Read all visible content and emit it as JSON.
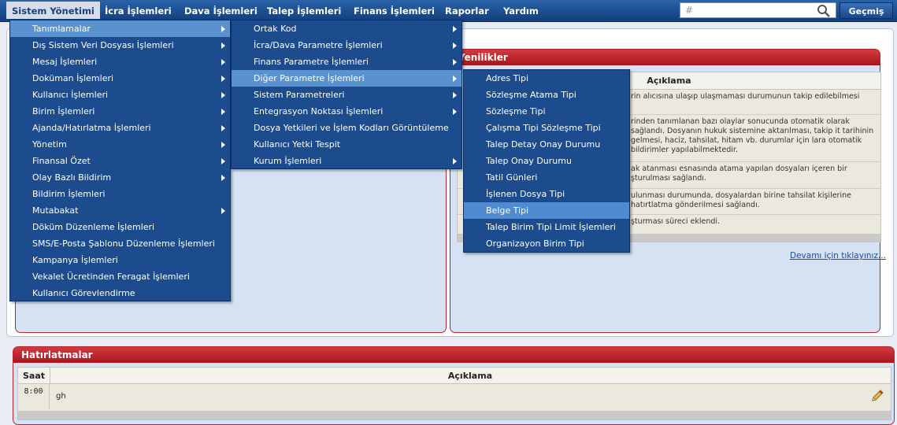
{
  "topbar": {
    "items": [
      "Sistem Yönetimi",
      "İcra İşlemleri",
      "Dava İşlemleri",
      "Talep İşlemleri",
      "Finans İşlemleri",
      "Raporlar",
      "Yardım"
    ],
    "search_placeholder": "#",
    "history_label": "Geçmiş"
  },
  "news_panel": {
    "title": "Yenilikler",
    "column": "Açıklama",
    "rows": [
      "rin alıcısına ulaşıp ulaşmaması durumunun takip edilebilmesi",
      "rinden tanımlanan bazı olaylar sonucunda otomatik olarak sağlandı. Dosyanın hukuk sistemine aktarılması, takip it tarihinin gelmesi, haciz, tahsilat, hitam vb. durumlar için lara otomatik bildirimler yapılabilmektedir.",
      "ak atanması esnasında atama yapılan dosyaları içeren bir şturulması sağlandı.",
      "ulunması durumunda, dosyalardan birine tahsilat kişilerine hatırtlatma gönderilmesi sağlandı.",
      "şturması süreci eklendi."
    ],
    "more_link": "Devamı için tıklayınız..."
  },
  "reminders": {
    "title": "Hatırlatmalar",
    "col_time": "Saat",
    "col_desc": "Açıklama",
    "rows": [
      {
        "time": "8:00",
        "desc": "gh"
      }
    ]
  },
  "menu1": {
    "items": [
      {
        "label": "Tanımlamalar",
        "sub": true
      },
      {
        "label": "Dış Sistem Veri Dosyası İşlemleri",
        "sub": true
      },
      {
        "label": "Mesaj İşlemleri",
        "sub": true
      },
      {
        "label": "Doküman İşlemleri",
        "sub": true
      },
      {
        "label": "Kullanıcı İşlemleri",
        "sub": true
      },
      {
        "label": "Birim İşlemleri",
        "sub": true
      },
      {
        "label": "Ajanda/Hatırlatma İşlemleri",
        "sub": true
      },
      {
        "label": "Yönetim",
        "sub": true
      },
      {
        "label": "Finansal Özet",
        "sub": true
      },
      {
        "label": "Olay Bazlı Bildirim",
        "sub": true
      },
      {
        "label": "Bildirim İşlemleri",
        "sub": false
      },
      {
        "label": "Mutabakat",
        "sub": true
      },
      {
        "label": "Döküm Düzenleme İşlemleri",
        "sub": false
      },
      {
        "label": "SMS/E-Posta Şablonu Düzenleme İşlemleri",
        "sub": false
      },
      {
        "label": "Kampanya İşlemleri",
        "sub": false
      },
      {
        "label": "Vekalet Ücretinden Feragat İşlemleri",
        "sub": false
      },
      {
        "label": "Kullanıcı Görevlendirme",
        "sub": false
      }
    ]
  },
  "menu2": {
    "items": [
      {
        "label": "Ortak Kod",
        "sub": true
      },
      {
        "label": "İcra/Dava Parametre İşlemleri",
        "sub": true
      },
      {
        "label": "Finans Parametre İşlemleri",
        "sub": true
      },
      {
        "label": "Diğer Parametre İşlemleri",
        "sub": true
      },
      {
        "label": "Sistem Parametreleri",
        "sub": true
      },
      {
        "label": "Entegrasyon Noktası İşlemleri",
        "sub": true
      },
      {
        "label": "Dosya Yetkileri ve İşlem Kodları Görüntüleme",
        "sub": false
      },
      {
        "label": "Kullanıcı Yetki Tespit",
        "sub": false
      },
      {
        "label": "Kurum İşlemleri",
        "sub": true
      }
    ]
  },
  "menu3": {
    "items": [
      {
        "label": "Adres Tipi"
      },
      {
        "label": "Sözleşme Atama Tipi"
      },
      {
        "label": "Sözleşme Tipi"
      },
      {
        "label": "Çalışma Tipi Sözleşme Tipi"
      },
      {
        "label": "Talep Detay Onay Durumu"
      },
      {
        "label": "Talep Onay Durumu"
      },
      {
        "label": "Tatil Günleri"
      },
      {
        "label": "İşlenen Dosya Tipi"
      },
      {
        "label": "Belge Tipi"
      },
      {
        "label": "Talep Birim Tipi Limit İşlemleri"
      },
      {
        "label": "Organizayon Birim Tipi"
      }
    ]
  }
}
